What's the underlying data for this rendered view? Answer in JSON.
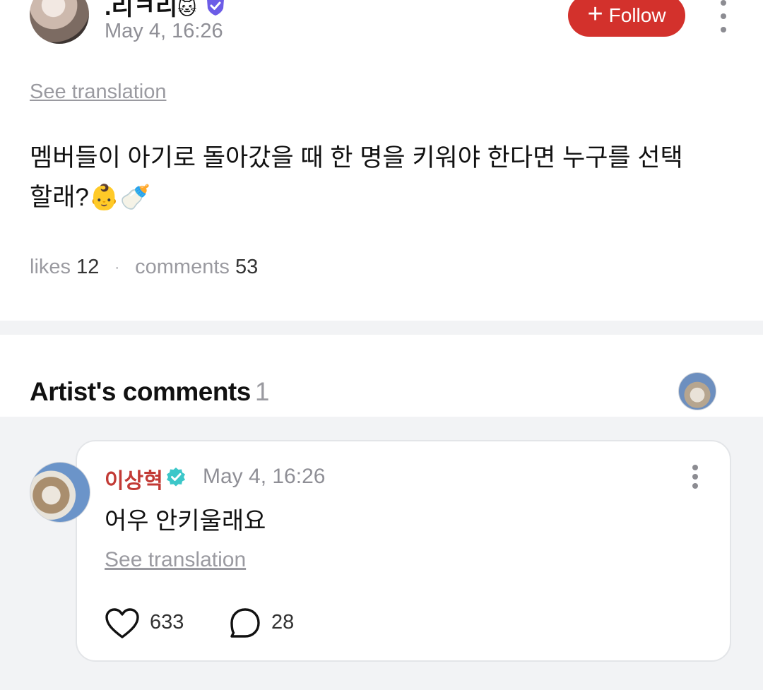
{
  "post": {
    "author_name": ".리ㅋ리",
    "author_emoji": "🐱",
    "time": "May 4, 16:26",
    "follow_label": "Follow",
    "see_translation": "See translation",
    "body_line1": "멤버들이 아기로 돌아갔을 때 한 명을 키워야 한다면 누구를 선택",
    "body_line2": "할래?👶🍼",
    "likes_label": "likes",
    "likes_count": "12",
    "comments_label": "comments",
    "comments_count": "53",
    "separator": "·"
  },
  "artist_comments": {
    "title": "Artist's comments",
    "count": "1",
    "items": [
      {
        "name": "이상혁",
        "time": "May 4, 16:26",
        "text": "어우 안키울래요",
        "see_translation": "See translation",
        "likes": "633",
        "replies": "28"
      }
    ]
  },
  "icons": {
    "verified_author": "verified-badge-icon",
    "verified_artist": "verified-badge-icon",
    "more": "more-vertical-icon",
    "like": "heart-icon",
    "reply": "comment-bubble-icon"
  },
  "colors": {
    "follow": "#d3312c",
    "artist_name": "#c23a35",
    "verified_purple": "#6c5ce7",
    "verified_teal": "#3cc7c9",
    "muted": "#9a9aa0",
    "band": "#f2f3f5"
  }
}
